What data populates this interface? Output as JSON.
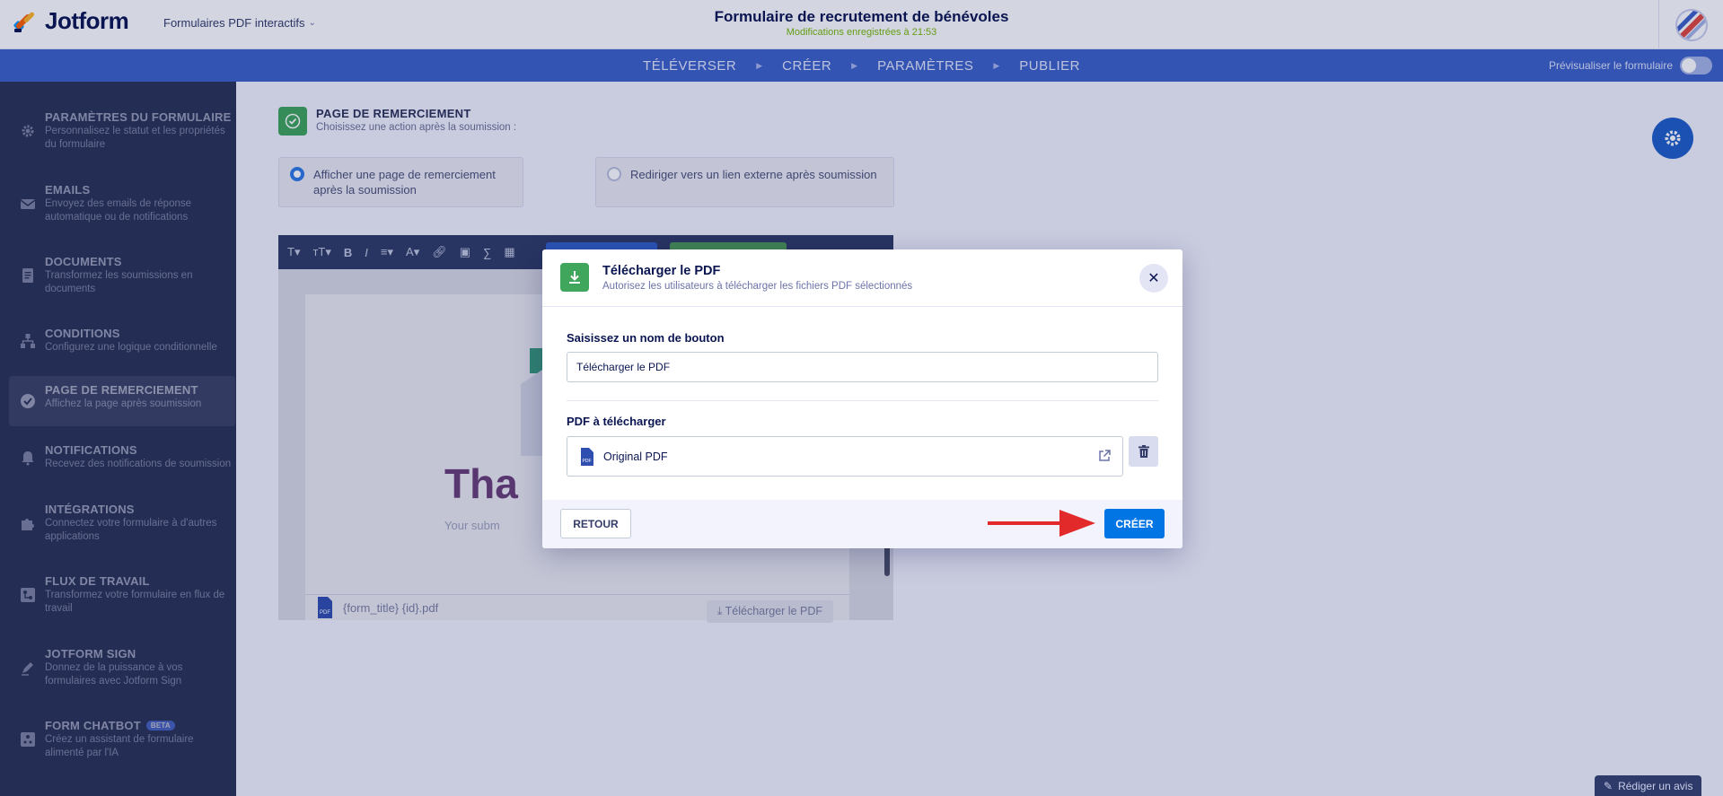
{
  "header": {
    "logo_text": "Jotform",
    "form_type": "Formulaires PDF interactifs",
    "form_title": "Formulaire de recrutement de bénévoles",
    "save_status": "Modifications enregistrées à 21:53"
  },
  "nav": {
    "tabs": [
      "TÉLÉVERSER",
      "CRÉER",
      "PARAMÈTRES",
      "PUBLIER"
    ],
    "preview_label": "Prévisualiser le formulaire"
  },
  "sidebar": {
    "items": [
      {
        "title": "PARAMÈTRES DU FORMULAIRE",
        "desc": "Personnalisez le statut et les propriétés du formulaire",
        "icon": "gear-icon"
      },
      {
        "title": "EMAILS",
        "desc": "Envoyez des emails de réponse automatique ou de notifications",
        "icon": "envelope-icon"
      },
      {
        "title": "DOCUMENTS",
        "desc": "Transformez les soumissions en documents",
        "icon": "document-icon"
      },
      {
        "title": "CONDITIONS",
        "desc": "Configurez une logique conditionnelle",
        "icon": "flow-icon"
      },
      {
        "title": "PAGE DE REMERCIEMENT",
        "desc": "Affichez la page après soumission",
        "icon": "check-circle-icon"
      },
      {
        "title": "NOTIFICATIONS",
        "desc": "Recevez des notifications de soumission",
        "icon": "bell-icon"
      },
      {
        "title": "INTÉGRATIONS",
        "desc": "Connectez votre formulaire à d'autres applications",
        "icon": "puzzle-icon"
      },
      {
        "title": "FLUX DE TRAVAIL",
        "desc": "Transformez votre formulaire en flux de travail",
        "icon": "workflow-icon"
      },
      {
        "title": "JOTFORM SIGN",
        "desc": "Donnez de la puissance à vos formulaires avec Jotform Sign",
        "icon": "pen-icon"
      },
      {
        "title": "FORM CHATBOT",
        "desc": "Créez un assistant de formulaire alimenté par l'IA",
        "icon": "chatbot-icon",
        "badge": "BETA"
      }
    ]
  },
  "main": {
    "section_title": "PAGE DE REMERCIEMENT",
    "section_sub": "Choisissez une action après la soumission :",
    "option_thankyou": "Afficher une page de remerciement après la soumission",
    "option_redirect": "Rediriger vers un lien externe après soumission",
    "thank_text": "Tha",
    "thank_sub": "Your subm",
    "pdf_filename": "{form_title} {id}.pdf",
    "pdf_download": "Télécharger le PDF"
  },
  "modal": {
    "title": "Télécharger le PDF",
    "subtitle": "Autorisez les utilisateurs à télécharger les fichiers PDF sélectionnés",
    "name_label": "Saisissez un nom de bouton",
    "name_value": "Télécharger le PDF",
    "pdf_label": "PDF à télécharger",
    "pdf_item": "Original PDF",
    "back_label": "RETOUR",
    "create_label": "CRÉER"
  },
  "review_button": "Rédiger un avis",
  "colors": {
    "nav_bg": "#3e62c8",
    "sidebar_bg": "#344067",
    "primary_button": "#0075e3",
    "success_green": "#3fa65b",
    "arrow_red": "#e32a2a"
  }
}
